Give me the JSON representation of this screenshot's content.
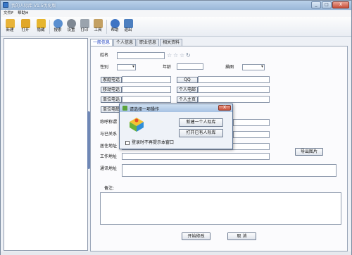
{
  "window": {
    "title": "我的人际库 V1.5优化版",
    "minimize": "_",
    "maximize": "□",
    "close": "X"
  },
  "menu": [
    "文件F",
    "帮助H"
  ],
  "toolbar": [
    {
      "label": "新建",
      "icon": "new-folder-icon",
      "color": "#e8b338"
    },
    {
      "label": "打开",
      "icon": "open-folder-icon",
      "color": "#e0a72a"
    },
    {
      "label": "隐藏",
      "icon": "lock-icon",
      "color": "#e6b52e"
    },
    {
      "label": "搜索",
      "icon": "search-icon",
      "color": "#5a8fd0"
    },
    {
      "label": "设置",
      "icon": "gear-icon",
      "color": "#7f8893"
    },
    {
      "label": "打印",
      "icon": "printer-icon",
      "color": "#9aa3ad"
    },
    {
      "label": "工具",
      "icon": "tools-icon",
      "color": "#c3a062"
    },
    {
      "label": "帮助",
      "icon": "help-icon",
      "color": "#3e74c4"
    },
    {
      "label": "退出",
      "icon": "exit-icon",
      "color": "#4c7fbf"
    }
  ],
  "tabs": [
    {
      "label": "一般信息",
      "active": true
    },
    {
      "label": "个人信息",
      "active": false
    },
    {
      "label": "职业信息",
      "active": false
    },
    {
      "label": "相关资料",
      "active": false
    }
  ],
  "form": {
    "name_label": "姓名",
    "gender_label": "性别",
    "age_label": "年龄",
    "age_value": "",
    "zodiac_label": "描图",
    "home_phone": "家庭电话",
    "qq": "QQ",
    "mobile": "移动电话",
    "email": "个人电邮",
    "work_phone": "单位电话",
    "homepage": "个人主页",
    "work_email": "单位电邮",
    "nickname_label": "称呼称谓",
    "relation_label": "与已关系",
    "address_label": "居住地址",
    "work_address_label": "工作地址",
    "mail_address_label": "通讯地址",
    "notes_label": "备注:",
    "export_photo": "导出图片",
    "start_edit": "开始修改",
    "cancel": "取 消"
  },
  "dialog": {
    "title": "请选择一项操作",
    "new_library": "新建一个人际库",
    "open_library": "打开已有人际库",
    "no_prompt": "登录时不再提示本窗口"
  },
  "colors": {
    "title_bar": "#9ab7d8",
    "active_tab_text": "#1c3fc0",
    "scroll_thumb": "#6f87b5"
  }
}
